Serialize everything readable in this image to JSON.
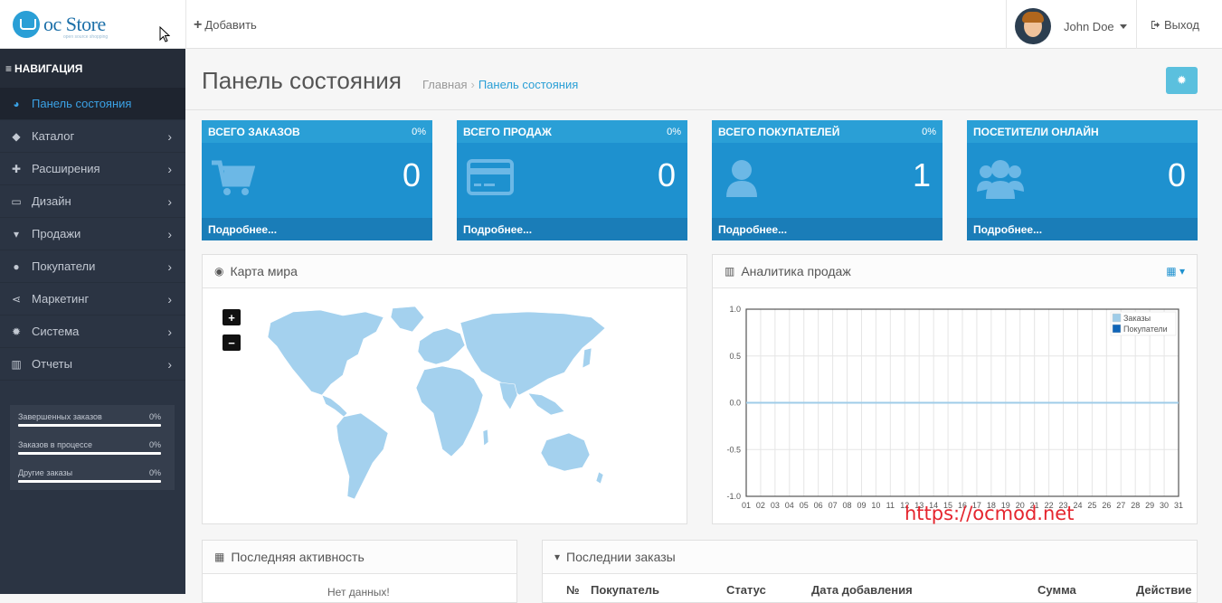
{
  "header": {
    "logo_text": "oc Store",
    "logo_sub": "open source shopping",
    "add_label": "Добавить",
    "user_name": "John Doe",
    "logout_label": "Выход"
  },
  "sidebar": {
    "nav_title": "НАВИГАЦИЯ",
    "items": [
      {
        "label": "Панель состояния",
        "icon": "dashboard-icon",
        "active": true
      },
      {
        "label": "Каталог",
        "icon": "tag-icon"
      },
      {
        "label": "Расширения",
        "icon": "puzzle-icon"
      },
      {
        "label": "Дизайн",
        "icon": "monitor-icon"
      },
      {
        "label": "Продажи",
        "icon": "cart-icon"
      },
      {
        "label": "Покупатели",
        "icon": "user-icon"
      },
      {
        "label": "Маркетинг",
        "icon": "share-icon"
      },
      {
        "label": "Система",
        "icon": "gear-icon"
      },
      {
        "label": "Отчеты",
        "icon": "bar-chart-icon"
      }
    ],
    "stats": [
      {
        "label": "Завершенных заказов",
        "value": "0%"
      },
      {
        "label": "Заказов в процессе",
        "value": "0%"
      },
      {
        "label": "Другие заказы",
        "value": "0%"
      }
    ]
  },
  "page": {
    "title": "Панель состояния",
    "breadcrumb_home": "Главная",
    "breadcrumb_sep": "›",
    "breadcrumb_current": "Панель состояния"
  },
  "tiles": [
    {
      "title": "ВСЕГО ЗАКАЗОВ",
      "percent": "0%",
      "value": "0",
      "footer": "Подробнее...",
      "icon": "cart-icon"
    },
    {
      "title": "ВСЕГО ПРОДАЖ",
      "percent": "0%",
      "value": "0",
      "footer": "Подробнее...",
      "icon": "credit-card-icon"
    },
    {
      "title": "ВСЕГО ПОКУПАТЕЛЕЙ",
      "percent": "0%",
      "value": "1",
      "footer": "Подробнее...",
      "icon": "user-icon"
    },
    {
      "title": "ПОСЕТИТЕЛИ ОНЛАЙН",
      "percent": "",
      "value": "0",
      "footer": "Подробнее...",
      "icon": "users-icon"
    }
  ],
  "map_panel": {
    "title": "Карта мира",
    "zoom_in": "+",
    "zoom_out": "−"
  },
  "sales_panel": {
    "title": "Аналитика продаж"
  },
  "chart_data": {
    "type": "line",
    "title": "",
    "x": [
      "01",
      "02",
      "03",
      "04",
      "05",
      "06",
      "07",
      "08",
      "09",
      "10",
      "11",
      "12",
      "13",
      "14",
      "15",
      "16",
      "17",
      "18",
      "19",
      "20",
      "21",
      "22",
      "23",
      "24",
      "25",
      "26",
      "27",
      "28",
      "29",
      "30",
      "31"
    ],
    "series": [
      {
        "name": "Заказы",
        "color": "#9fcce8",
        "values": [
          0,
          0,
          0,
          0,
          0,
          0,
          0,
          0,
          0,
          0,
          0,
          0,
          0,
          0,
          0,
          0,
          0,
          0,
          0,
          0,
          0,
          0,
          0,
          0,
          0,
          0,
          0,
          0,
          0,
          0,
          0
        ]
      },
      {
        "name": "Покупатели",
        "color": "#1065b7",
        "values": [
          0,
          0,
          0,
          0,
          0,
          0,
          0,
          0,
          0,
          0,
          0,
          0,
          0,
          0,
          0,
          0,
          0,
          0,
          0,
          0,
          0,
          0,
          0,
          0,
          0,
          0,
          0,
          0,
          0,
          0,
          0
        ]
      }
    ],
    "yticks": [
      "1.0",
      "0.5",
      "0.0",
      "-0.5",
      "-1.0"
    ],
    "ylim": [
      -1,
      1
    ],
    "grid": true,
    "legend": "top-right"
  },
  "activity_panel": {
    "title": "Последняя активность",
    "no_data": "Нет данных!"
  },
  "orders_panel": {
    "title": "Последнии заказы",
    "columns": [
      "№",
      "Покупатель",
      "Статус",
      "Дата добавления",
      "Сумма",
      "Действие"
    ]
  },
  "watermark": "https://ocmod.net",
  "colors": {
    "accent": "#2a9fd6",
    "tile_bg": "#1e91cf",
    "sidebar_bg": "#2b3443"
  }
}
